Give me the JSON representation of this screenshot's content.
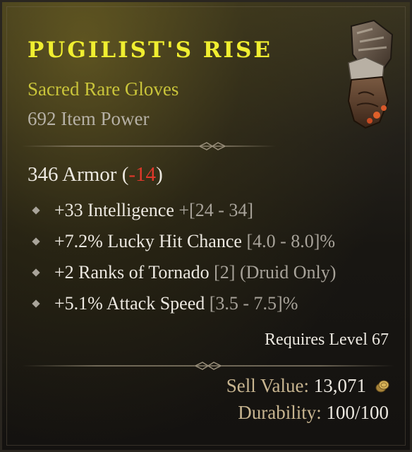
{
  "item": {
    "name": "PUGILIST'S RISE",
    "type": "Sacred Rare Gloves",
    "item_power": "692 Item Power",
    "icon": "gloves-icon"
  },
  "armor": {
    "value": "346 Armor",
    "open": " (",
    "delta": "-14",
    "close": ")"
  },
  "affixes": [
    {
      "value": "+33 Intelligence ",
      "range": "+[24 - 34]"
    },
    {
      "value": "+7.2% Lucky Hit Chance ",
      "range": "[4.0 - 8.0]%"
    },
    {
      "value": "+2 Ranks of Tornado ",
      "range": "[2] (Druid Only)"
    },
    {
      "value": "+5.1% Attack Speed ",
      "range": "[3.5 - 7.5]%"
    }
  ],
  "requirements": {
    "level": "Requires Level 67"
  },
  "footer": {
    "sell_label": "Sell Value:",
    "sell_value": " 13,071",
    "sell_icon": "gold-coin-icon",
    "durability_label": "Durability:",
    "durability_value": " 100/100"
  },
  "colors": {
    "title": "#f0ee30",
    "rare": "#c9c43a",
    "negative": "#e0382a"
  }
}
